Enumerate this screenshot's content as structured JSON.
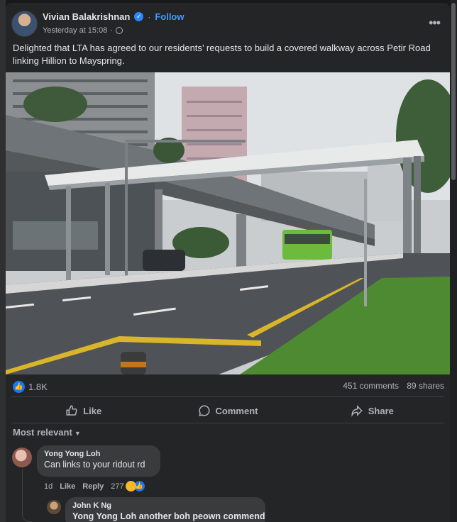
{
  "post": {
    "author": "Vivian Balakrishnan",
    "follow_label": "Follow",
    "timestamp": "Yesterday at 15:08",
    "caption": "Delighted that LTA has agreed to our residents’ requests to build a covered walkway across Petir Road linking Hillion to Mayspring.",
    "reactions_count": "1.8K",
    "comments_count": "451 comments",
    "shares_count": "89 shares"
  },
  "actions": {
    "like": "Like",
    "comment": "Comment",
    "share": "Share"
  },
  "sort_label": "Most relevant",
  "comments": [
    {
      "author": "Yong Yong Loh",
      "text": "Can links to your ridout rd",
      "time": "1d",
      "like": "Like",
      "reply": "Reply",
      "reaction_count": "277"
    },
    {
      "author": "John K Ng",
      "text": "Yong Yong Loh another boh peown commend"
    }
  ],
  "colors": {
    "background": "#18191a",
    "card": "#242526",
    "accent": "#4599ff",
    "like_blue": "#1877f2"
  },
  "icons": [
    "verified-icon",
    "globe-icon",
    "more-options-icon",
    "like-icon",
    "comment-icon",
    "share-icon",
    "chevron-down-icon"
  ]
}
